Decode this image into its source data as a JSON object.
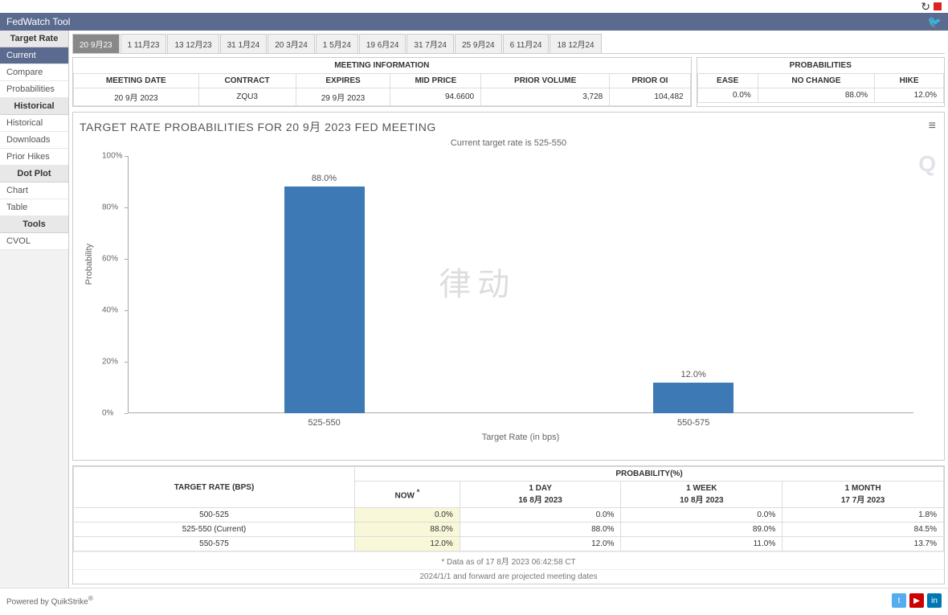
{
  "app_title": "FedWatch Tool",
  "sidebar": {
    "groups": [
      {
        "header": "Target Rate",
        "items": [
          "Current",
          "Compare",
          "Probabilities"
        ],
        "active": 0
      },
      {
        "header": "Historical",
        "items": [
          "Historical",
          "Downloads",
          "Prior Hikes"
        ],
        "active": -1
      },
      {
        "header": "Dot Plot",
        "items": [
          "Chart",
          "Table"
        ],
        "active": -1
      },
      {
        "header": "Tools",
        "items": [
          "CVOL"
        ],
        "active": -1
      }
    ]
  },
  "tabs": [
    "20 9月23",
    "1 11月23",
    "13 12月23",
    "31 1月24",
    "20 3月24",
    "1 5月24",
    "19 6月24",
    "31 7月24",
    "25 9月24",
    "6 11月24",
    "18 12月24"
  ],
  "active_tab": 0,
  "meeting_info": {
    "title": "MEETING INFORMATION",
    "headers": [
      "MEETING DATE",
      "CONTRACT",
      "EXPIRES",
      "MID PRICE",
      "PRIOR VOLUME",
      "PRIOR OI"
    ],
    "row": [
      "20 9月 2023",
      "ZQU3",
      "29 9月 2023",
      "94.6600",
      "3,728",
      "104,482"
    ]
  },
  "probabilities_summary": {
    "title": "PROBABILITIES",
    "headers": [
      "EASE",
      "NO CHANGE",
      "HIKE"
    ],
    "row": [
      "0.0%",
      "88.0%",
      "12.0%"
    ]
  },
  "chart_title": "TARGET RATE PROBABILITIES FOR 20 9月 2023 FED MEETING",
  "chart_subtitle": "Current target rate is 525-550",
  "chart_data": {
    "type": "bar",
    "categories": [
      "525-550",
      "550-575"
    ],
    "values": [
      88.0,
      12.0
    ],
    "value_labels": [
      "88.0%",
      "12.0%"
    ],
    "title": "TARGET RATE PROBABILITIES FOR 20 9月 2023 FED MEETING",
    "subtitle": "Current target rate is 525-550",
    "xlabel": "Target Rate (in bps)",
    "ylabel": "Probability",
    "ylim": [
      0,
      100
    ],
    "yticks": [
      "0%",
      "20%",
      "40%",
      "60%",
      "80%",
      "100%"
    ]
  },
  "history_table": {
    "row_header": "TARGET RATE (BPS)",
    "col_header": "PROBABILITY(%)",
    "columns": [
      {
        "top": "NOW",
        "sub": ""
      },
      {
        "top": "1 DAY",
        "sub": "16 8月 2023"
      },
      {
        "top": "1 WEEK",
        "sub": "10 8月 2023"
      },
      {
        "top": "1 MONTH",
        "sub": "17 7月 2023"
      }
    ],
    "rows": [
      {
        "label": "500-525",
        "values": [
          "0.0%",
          "0.0%",
          "0.0%",
          "1.8%"
        ]
      },
      {
        "label": "525-550 (Current)",
        "values": [
          "88.0%",
          "88.0%",
          "89.0%",
          "84.5%"
        ]
      },
      {
        "label": "550-575",
        "values": [
          "12.0%",
          "12.0%",
          "11.0%",
          "13.7%"
        ]
      }
    ],
    "data_note": "* Data as of 17 8月 2023 06:42:58 CT",
    "forward_note": "2024/1/1 and forward are projected meeting dates"
  },
  "footer": {
    "powered": "Powered by QuikStrike",
    "reg": "®"
  }
}
